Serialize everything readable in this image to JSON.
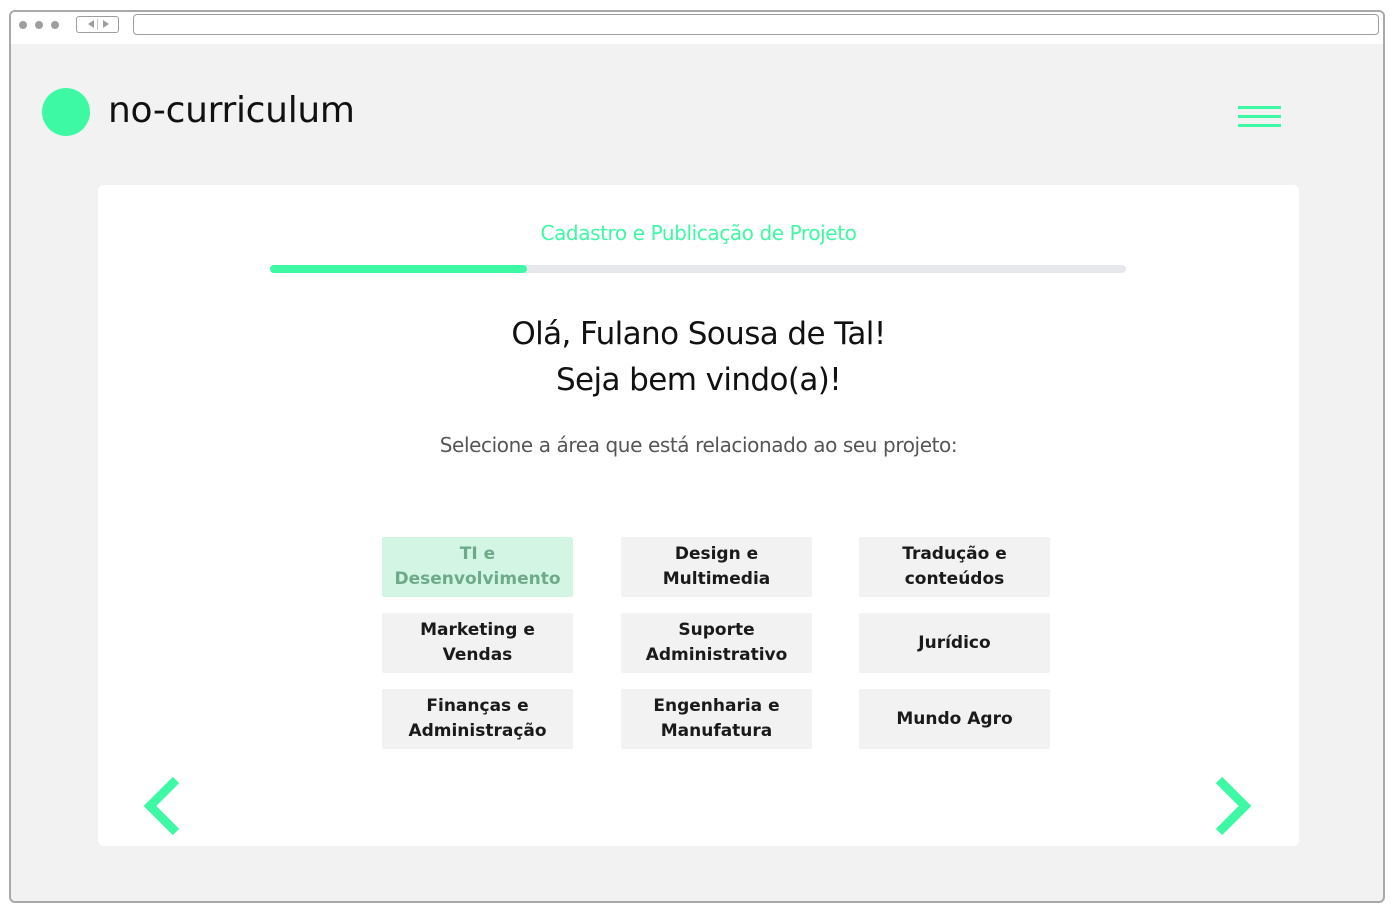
{
  "brand": {
    "name": "no-curriculum",
    "accent_color": "#3ef9a3"
  },
  "header": {
    "menu_icon": "hamburger-menu-icon"
  },
  "wizard": {
    "step_title": "Cadastro e Publicação de Projeto",
    "progress_fraction": 0.3,
    "greeting_line1": "Olá, Fulano Sousa de Tal!",
    "greeting_line2": "Seja bem vindo(a)!",
    "instruction": "Selecione a área que está relacionado ao seu projeto:",
    "areas": [
      {
        "label": "TI e\nDesenvolvimento",
        "selected": true
      },
      {
        "label": "Design e\nMultimedia",
        "selected": false
      },
      {
        "label": "Tradução e\nconteúdos",
        "selected": false
      },
      {
        "label": "Marketing e\nVendas",
        "selected": false
      },
      {
        "label": "Suporte\nAdministrativo",
        "selected": false
      },
      {
        "label": "Jurídico",
        "selected": false
      },
      {
        "label": "Finanças e\nAdministração",
        "selected": false
      },
      {
        "label": "Engenharia e\nManufatura",
        "selected": false
      },
      {
        "label": "Mundo Agro",
        "selected": false
      }
    ],
    "prev_icon": "chevron-left-icon",
    "next_icon": "chevron-right-icon"
  }
}
